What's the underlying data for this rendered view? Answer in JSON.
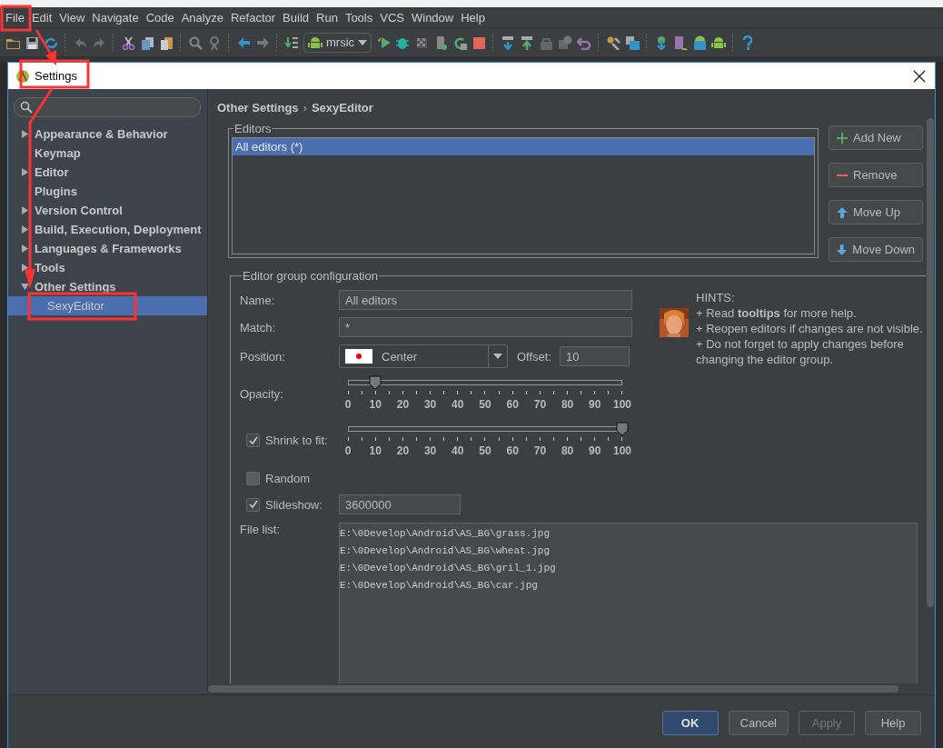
{
  "menu_bar": {
    "items": [
      "File",
      "Edit",
      "View",
      "Navigate",
      "Code",
      "Analyze",
      "Refactor",
      "Build",
      "Run",
      "Tools",
      "VCS",
      "Window",
      "Help"
    ]
  },
  "toolbar": {
    "run_config": "mrsic"
  },
  "dialog": {
    "title": "Settings"
  },
  "sidebar": {
    "tree": [
      {
        "label": "Appearance & Behavior",
        "kind": "folder",
        "expanded": false,
        "selected": false
      },
      {
        "label": "Keymap",
        "kind": "leaf",
        "selected": false
      },
      {
        "label": "Editor",
        "kind": "folder",
        "expanded": false,
        "selected": false
      },
      {
        "label": "Plugins",
        "kind": "leaf",
        "selected": false
      },
      {
        "label": "Version Control",
        "kind": "folder",
        "expanded": false,
        "selected": false
      },
      {
        "label": "Build, Execution, Deployment",
        "kind": "folder",
        "expanded": false,
        "selected": false
      },
      {
        "label": "Languages & Frameworks",
        "kind": "folder",
        "expanded": false,
        "selected": false
      },
      {
        "label": "Tools",
        "kind": "folder",
        "expanded": false,
        "selected": false
      },
      {
        "label": "Other Settings",
        "kind": "folder",
        "expanded": true,
        "selected": false,
        "children": [
          {
            "label": "SexyEditor",
            "kind": "leaf",
            "selected": true
          }
        ]
      }
    ]
  },
  "breadcrumb": {
    "items": [
      "Other Settings",
      "SexyEditor"
    ],
    "separator": "›"
  },
  "editors": {
    "legend": "Editors",
    "items": [
      {
        "label": "All editors (*)",
        "selected": true
      }
    ]
  },
  "editor_buttons": [
    {
      "label": "Add New",
      "kind": "add"
    },
    {
      "label": "Remove",
      "kind": "remove"
    },
    {
      "label": "Move Up",
      "kind": "up"
    },
    {
      "label": "Move Down",
      "kind": "down"
    }
  ],
  "group_config": {
    "legend": "Editor group configuration",
    "name": {
      "label": "Name:",
      "value": "All editors"
    },
    "match": {
      "label": "Match:",
      "value": "*"
    },
    "position": {
      "label": "Position:",
      "value": "Center"
    },
    "offset": {
      "label": "Offset:",
      "value": "10"
    },
    "opacity": {
      "label": "Opacity:",
      "level": 0.1,
      "ticks": [
        "0",
        "10",
        "20",
        "30",
        "40",
        "50",
        "60",
        "70",
        "80",
        "90",
        "100"
      ]
    },
    "shrink_to_fit": {
      "label": "Shrink to fit:",
      "checked": true,
      "level": 1.0,
      "ticks": [
        "0",
        "10",
        "20",
        "30",
        "40",
        "50",
        "60",
        "70",
        "80",
        "90",
        "100"
      ]
    },
    "random": {
      "label": "Random",
      "checked": false
    },
    "slideshow": {
      "label": "Slideshow:",
      "checked": true,
      "value": "3600000"
    },
    "file_list": {
      "label": "File list:",
      "lines": [
        "E:\\0Develop\\Android\\AS_BG\\grass.jpg",
        "E:\\0Develop\\Android\\AS_BG\\wheat.jpg",
        "E:\\0Develop\\Android\\AS_BG\\gril_1.jpg",
        "E:\\0Develop\\Android\\AS_BG\\car.jpg"
      ]
    }
  },
  "hints": {
    "title": "HINTS:",
    "lines": [
      "+ Read **tooltips** for more help.",
      "+ Reopen editors if changes are not visible.",
      "+ Do not forget to apply changes before changing the editor group."
    ]
  },
  "footer_buttons": [
    {
      "label": "OK",
      "kind": "default",
      "disabled": false
    },
    {
      "label": "Cancel",
      "kind": "normal",
      "disabled": false
    },
    {
      "label": "Apply",
      "kind": "normal",
      "disabled": true
    },
    {
      "label": "Help",
      "kind": "normal",
      "disabled": false
    }
  ]
}
